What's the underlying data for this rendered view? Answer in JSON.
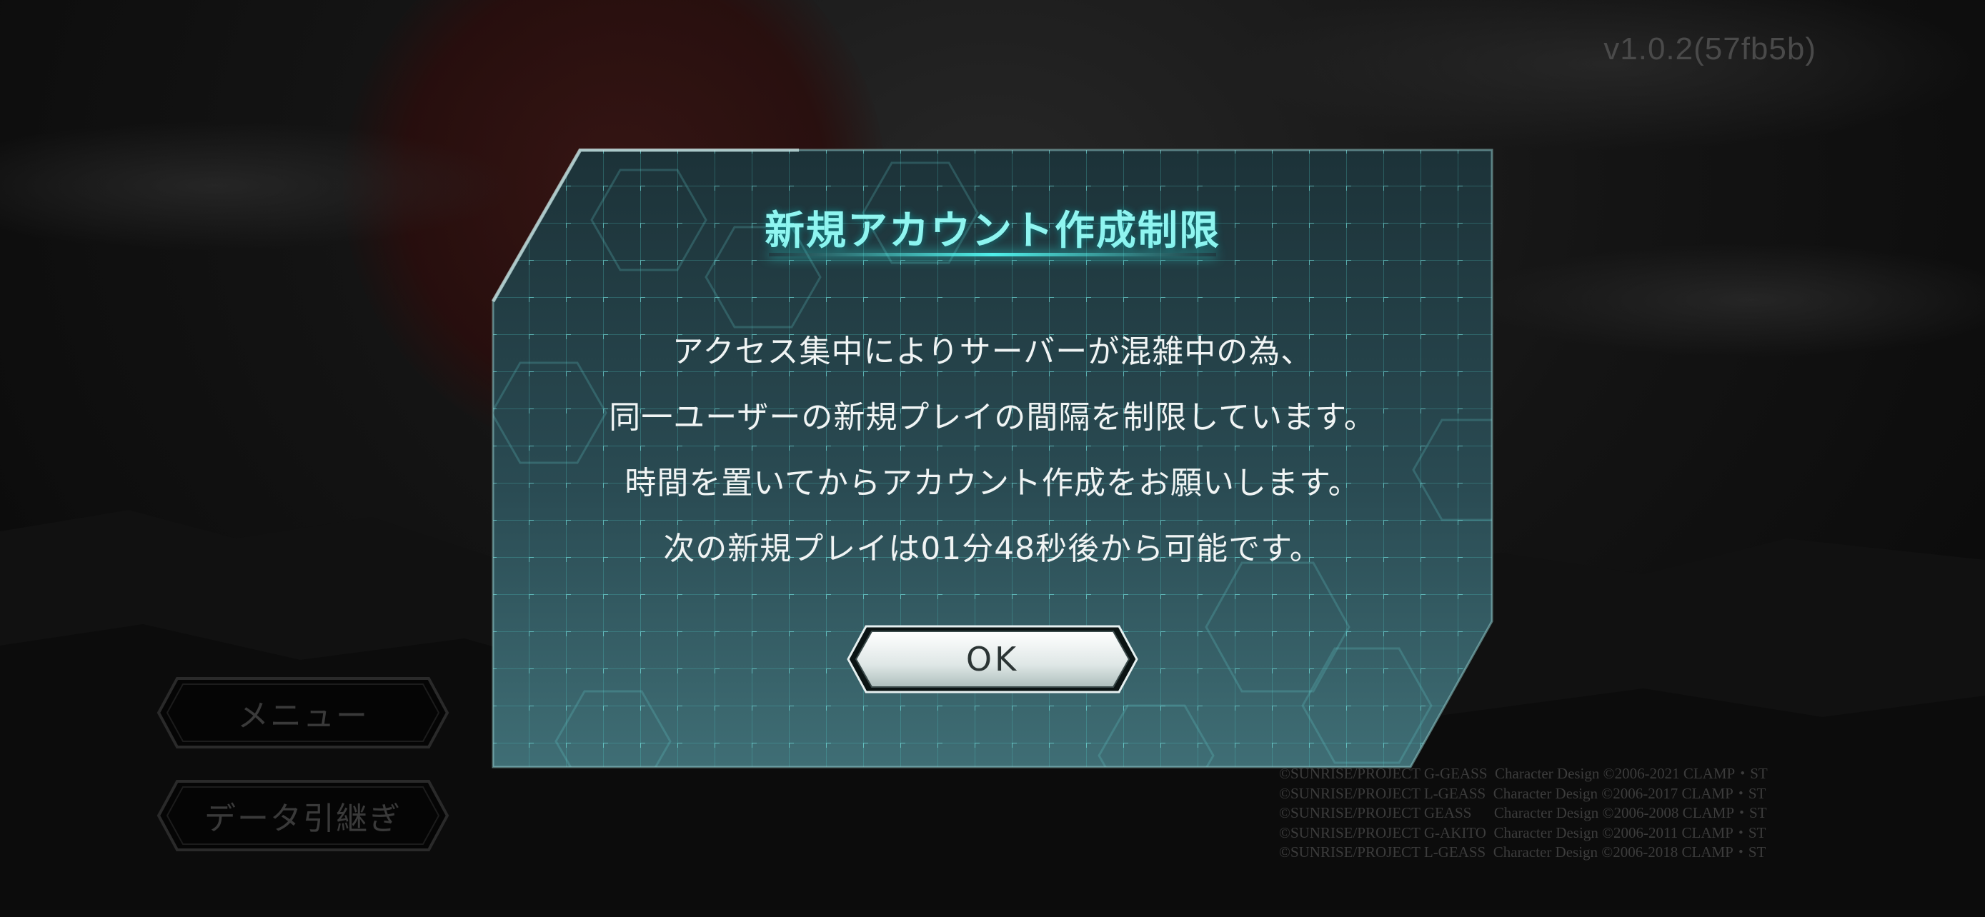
{
  "version": "v1.0.2(57fb5b)",
  "menu": {
    "menu_label": "メニュー",
    "transfer_label": "データ引継ぎ"
  },
  "copyright": [
    "©SUNRISE/PROJECT G-GEASS  Character Design ©2006-2021 CLAMP・ST",
    "©SUNRISE/PROJECT L-GEASS  Character Design ©2006-2017 CLAMP・ST",
    "©SUNRISE/PROJECT GEASS      Character Design ©2006-2008 CLAMP・ST",
    "©SUNRISE/PROJECT G-AKITO  Character Design ©2006-2011 CLAMP・ST",
    "©SUNRISE/PROJECT L-GEASS  Character Design ©2006-2018 CLAMP・ST"
  ],
  "dialog": {
    "title": "新規アカウント作成制限",
    "lines": [
      "アクセス集中によりサーバーが混雑中の為、",
      "同一ユーザーの新規プレイの間隔を制限しています。",
      "時間を置いてからアカウント作成をお願いします。",
      "次の新規プレイは01分48秒後から可能です。"
    ],
    "ok_label": "OK"
  },
  "colors": {
    "accent": "#8ff5f0",
    "panel": "#2c4f57",
    "grid": "#5fd8d6"
  }
}
